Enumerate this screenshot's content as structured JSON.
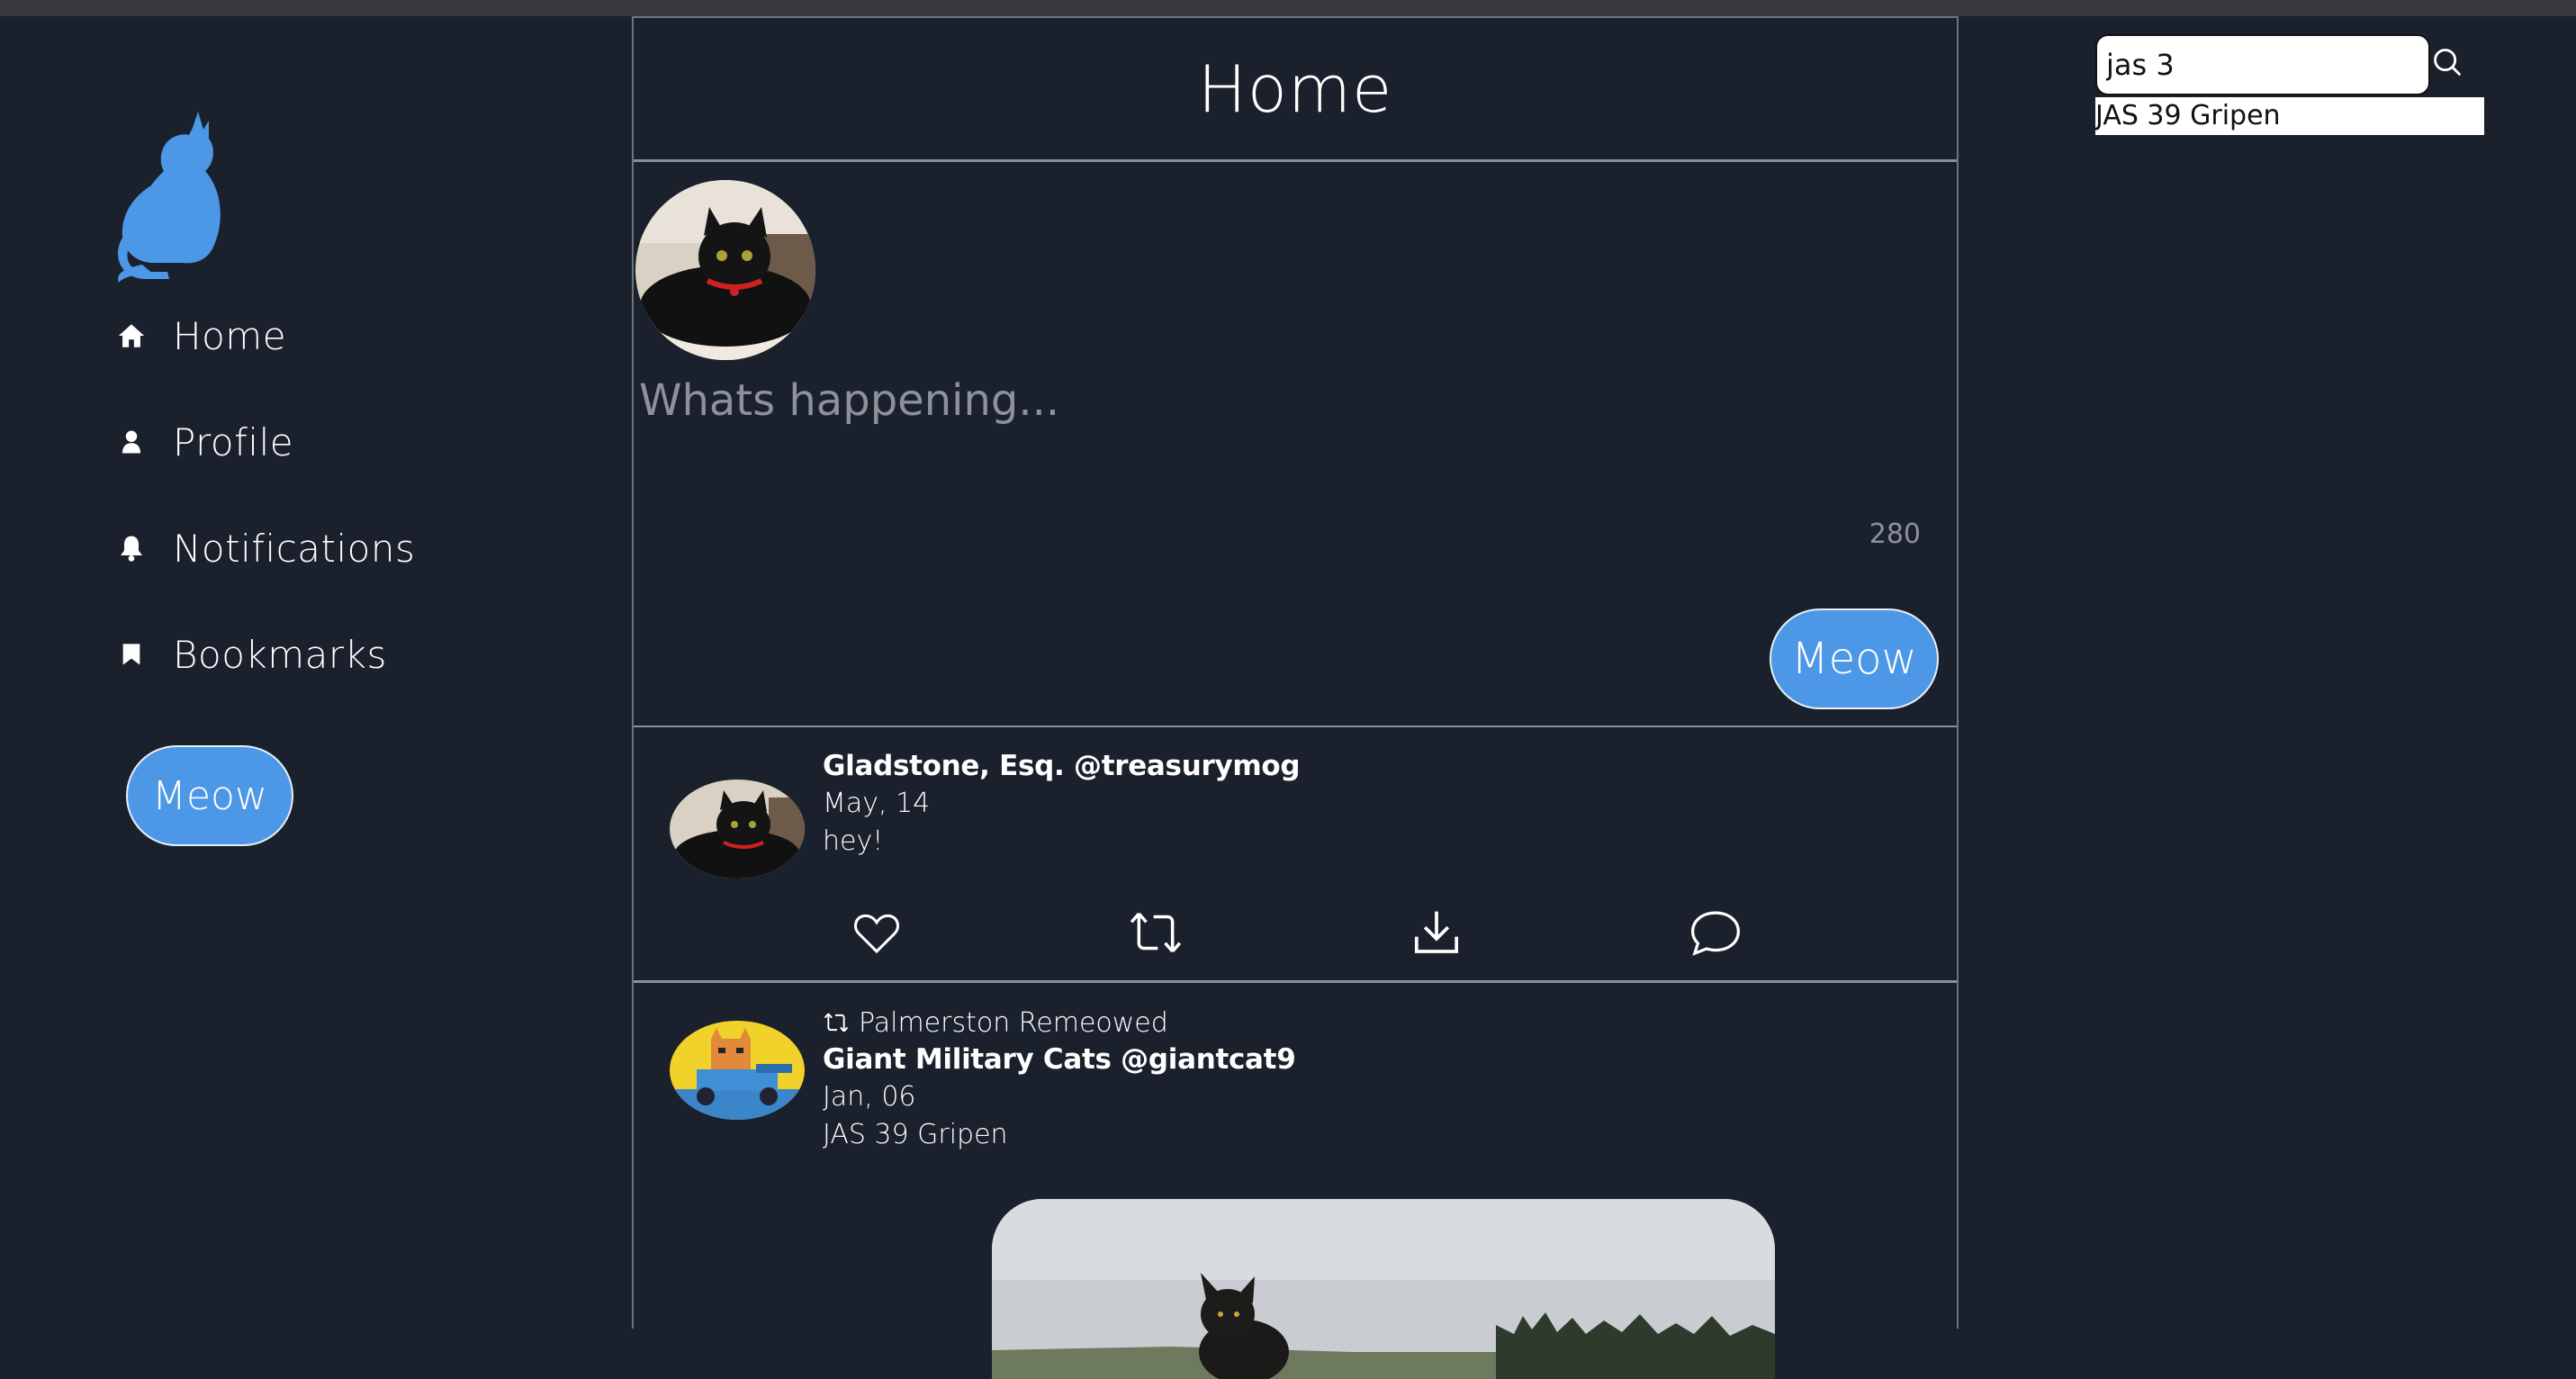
{
  "sidebar": {
    "logo": "cat-logo",
    "items": [
      {
        "label": "Home",
        "icon": "home-icon"
      },
      {
        "label": "Profile",
        "icon": "user-icon"
      },
      {
        "label": "Notifications",
        "icon": "bell-icon"
      },
      {
        "label": "Bookmarks",
        "icon": "bookmark-icon"
      }
    ],
    "meow_label": "Meow"
  },
  "header": {
    "title": "Home"
  },
  "compose": {
    "placeholder": "Whats happening...",
    "char_count": "280",
    "meow_label": "Meow"
  },
  "tweets": [
    {
      "author": "Gladstone, Esq. @treasurymog",
      "date": "May, 14",
      "text": "hey!"
    },
    {
      "retweeted_by": "Palmerston Remeowed",
      "author": "Giant Military Cats @giantcat9",
      "date": "Jan, 06",
      "text": "JAS 39 Gripen"
    }
  ],
  "search": {
    "value": "jas 3",
    "suggestion": "JAS 39 Gripen"
  },
  "colors": {
    "background": "#1a202c",
    "accent": "#4d98e6"
  }
}
